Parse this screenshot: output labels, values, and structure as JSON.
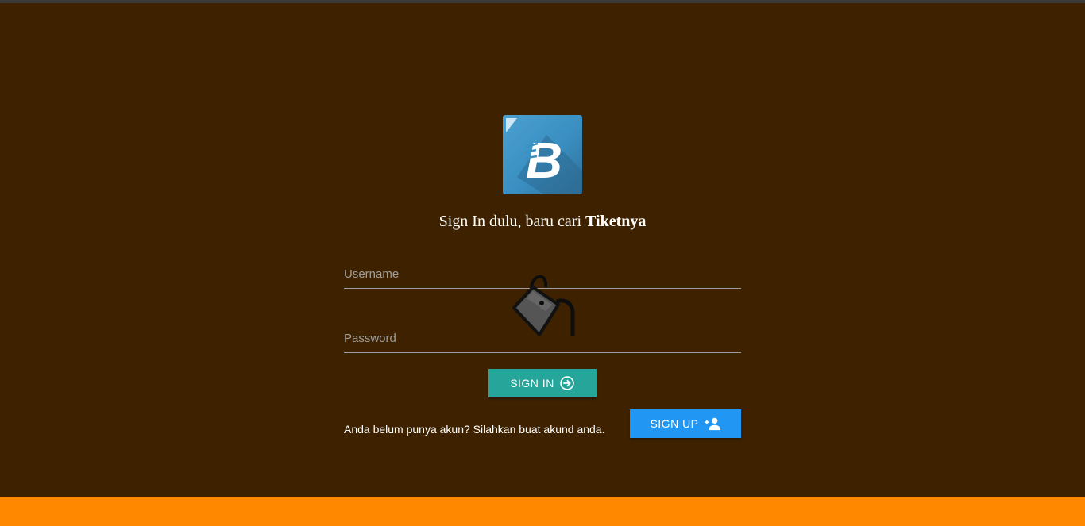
{
  "logo": {
    "letter": "B"
  },
  "headline": {
    "prefix": "Sign In dulu, baru cari ",
    "bold": "Tiketnya"
  },
  "form": {
    "username_placeholder": "Username",
    "username_value": "",
    "password_placeholder": "Password",
    "password_value": ""
  },
  "signin": {
    "label": "SIGN IN",
    "icon": "arrow-circle-right-icon"
  },
  "signup_prompt": "Anda belum punya akun? Silahkan buat akund anda.",
  "signup": {
    "label": "SIGN UP",
    "icon": "person-add-icon"
  },
  "overlay_icon": "paint-bucket-icon",
  "colors": {
    "background": "#3e2200",
    "footer": "#ff8800",
    "signin_button": "#26a69a",
    "signup_button": "#2196f3",
    "logo": "#3a8fc2"
  }
}
